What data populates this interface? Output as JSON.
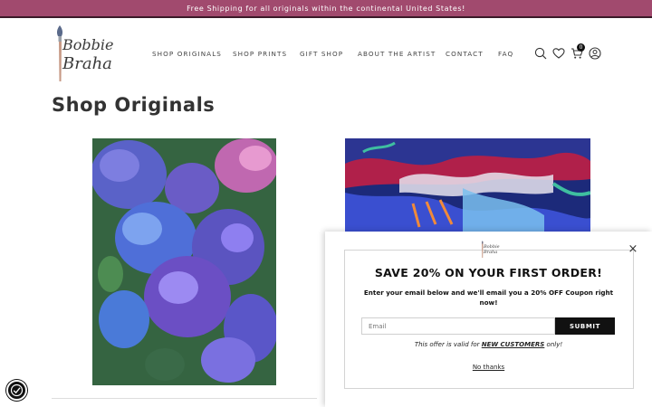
{
  "announcement": "Free Shipping for all originals within the continental United States!",
  "logo": {
    "line1": "Bobbie",
    "line2": "Braha"
  },
  "nav": [
    {
      "label": "SHOP ORIGINALS"
    },
    {
      "label": "SHOP PRINTS"
    },
    {
      "label": "GIFT SHOP"
    },
    {
      "label": "ABOUT THE ARTIST"
    },
    {
      "label": "CONTACT"
    },
    {
      "label": "FAQ"
    }
  ],
  "header_icons": [
    "search-icon",
    "heart-icon",
    "cart-icon",
    "account-icon"
  ],
  "cart_count": "0",
  "page_title": "Shop Originals",
  "popup": {
    "logo_line1": "Bobbie",
    "logo_line2": "Braha",
    "headline": "SAVE 20% ON YOUR FIRST ORDER!",
    "subtext": "Enter your email below and we'll email you a 20% OFF Coupon right now!",
    "email_placeholder": "Email",
    "submit_label": "SUBMIT",
    "note_prefix": "This offer is valid for ",
    "note_emphasis": "NEW CUSTOMERS",
    "note_suffix": " only!",
    "dismiss_label": "No thanks",
    "close_symbol": "×"
  },
  "colors": {
    "announcement_bg": "#a14a6e",
    "button_bg": "#111111"
  }
}
